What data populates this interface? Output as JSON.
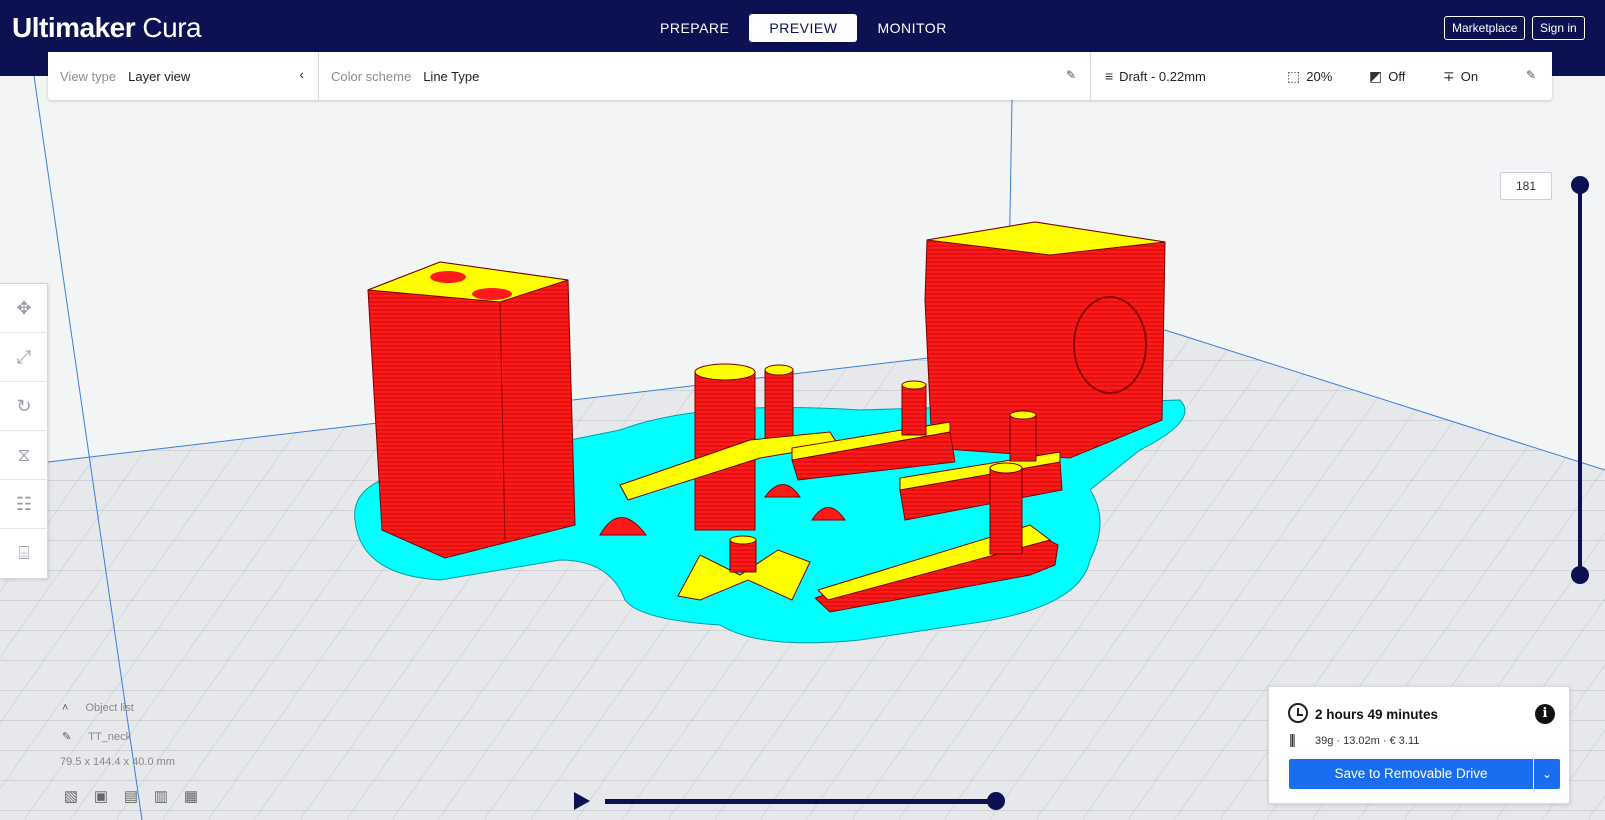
{
  "app": {
    "brand_bold": "Ultimaker",
    "brand_light": "Cura"
  },
  "header": {
    "stages": [
      {
        "label": "PREPARE"
      },
      {
        "label": "PREVIEW",
        "active": true
      },
      {
        "label": "MONITOR"
      }
    ],
    "marketplace": "Marketplace",
    "sign_in": "Sign in"
  },
  "settings": {
    "view_type_label": "View type",
    "view_type_value": "Layer view",
    "color_scheme_label": "Color scheme",
    "color_scheme_value": "Line Type",
    "profile": "Draft - 0.22mm",
    "infill": "20%",
    "support": "Off",
    "adhesion": "On"
  },
  "layer_slider": {
    "current_layer": "181"
  },
  "object_list": {
    "title": "Object list",
    "object_name": "TT_neck",
    "dimensions": "79.5 x 144.4 x 40.0 mm"
  },
  "print_info": {
    "time": "2 hours 49 minutes",
    "material": "39g · 13.02m · € 3.11",
    "save_button": "Save to Removable Drive"
  },
  "colors": {
    "header": "#0c1151",
    "accent": "#196ef0",
    "wall": "#ff1a1a",
    "skin": "#ffff00",
    "skirt": "#00ffff"
  },
  "icons": {
    "toolbar": [
      "move-icon",
      "scale-icon",
      "rotate-icon",
      "mirror-icon",
      "per-model-settings-icon",
      "support-blocker-icon"
    ],
    "view_orientation": [
      "3d-view-icon",
      "front-view-icon",
      "top-view-icon",
      "left-view-icon",
      "right-view-icon"
    ]
  }
}
